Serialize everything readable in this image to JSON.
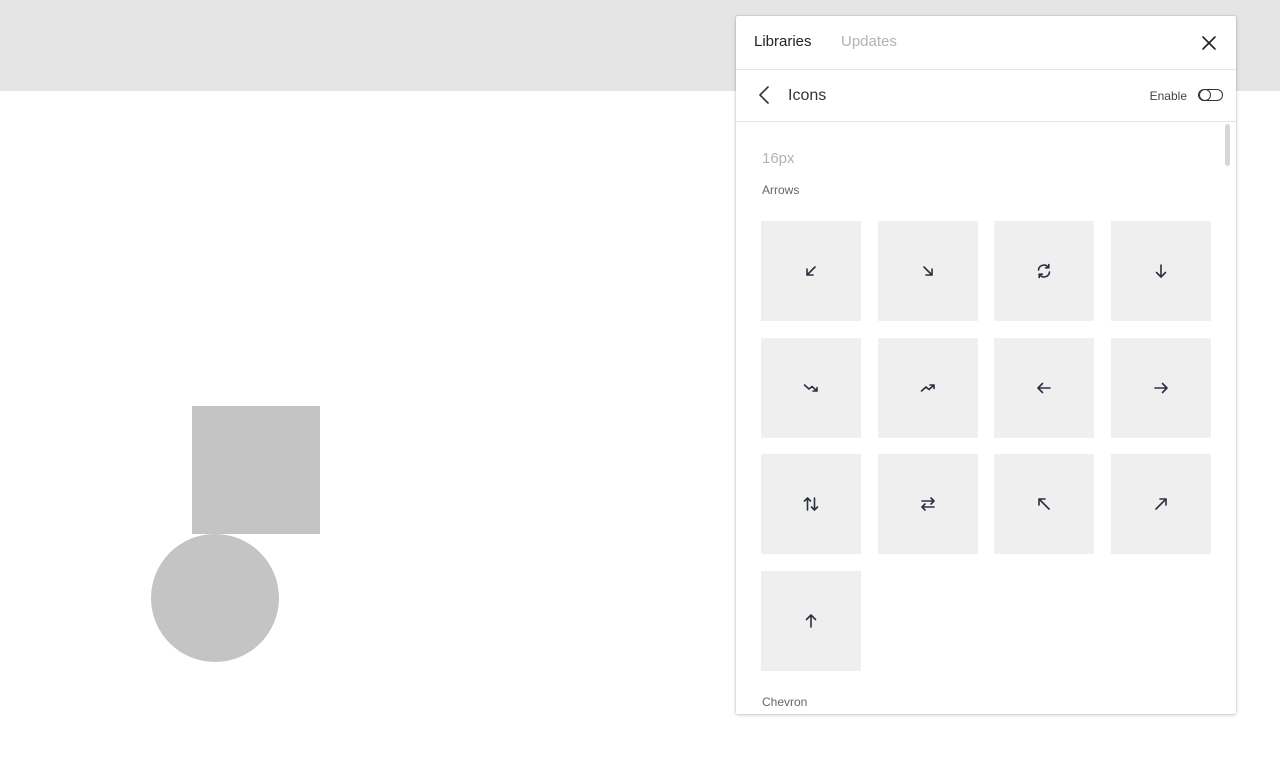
{
  "panel": {
    "tabs": [
      {
        "label": "Libraries",
        "active": true
      },
      {
        "label": "Updates",
        "active": false
      }
    ],
    "close_icon": "close-icon"
  },
  "subheader": {
    "back_icon": "chevron-left-icon",
    "title": "Icons",
    "enable_label": "Enable",
    "enabled": false
  },
  "content": {
    "size_heading": "16px",
    "sections": [
      {
        "label": "Arrows",
        "icons": [
          "arrow-down-left-icon",
          "arrow-down-right-icon",
          "refresh-icon",
          "arrow-down-icon",
          "trend-down-icon",
          "trend-up-icon",
          "arrow-left-icon",
          "arrow-right-icon",
          "arrows-up-down-icon",
          "arrows-swap-horizontal-icon",
          "arrow-up-left-icon",
          "arrow-up-right-icon",
          "arrow-up-icon"
        ]
      },
      {
        "label": "Chevron",
        "icons": []
      }
    ]
  },
  "colors": {
    "topbar_bg": "#e5e5e5",
    "shape_fill": "#c4c4c4",
    "tile_bg": "#efefef",
    "icon_stroke": "#2a3040",
    "inactive_tab": "#b3b3b3"
  }
}
